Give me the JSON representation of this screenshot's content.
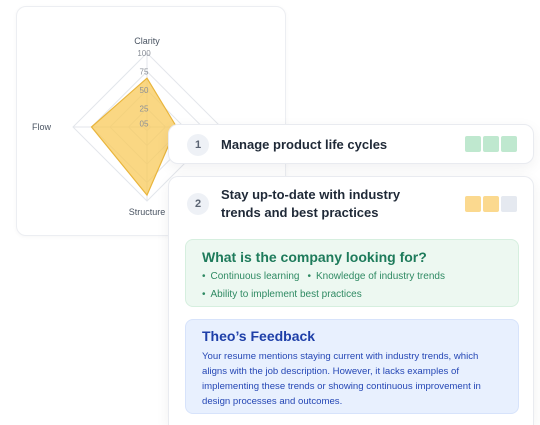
{
  "radar": {
    "axes": [
      "Clarity",
      "",
      "Structure",
      "Flow"
    ],
    "ticks": [
      "100",
      "75",
      "50",
      "25",
      "05"
    ],
    "fill_color": "#f8c95a",
    "stroke_color": "#e9b53c",
    "values": [
      66,
      40,
      92,
      75
    ]
  },
  "rows": [
    {
      "number": "1",
      "title": "Manage product life cycles",
      "rating": [
        "#bfe8cf",
        "#bfe8cf",
        "#bfe8cf"
      ]
    },
    {
      "number": "2",
      "title_line1": "Stay up-to-date with industry",
      "title_line2": "trends and best practices",
      "rating": [
        "#fbd98f",
        "#fbd98f",
        "#e5e9f0"
      ]
    }
  ],
  "looking_for": {
    "title": "What is the company looking for?",
    "items": [
      "Continuous learning",
      "Knowledge of industry trends",
      "Ability to implement best practices"
    ],
    "bullet": "•"
  },
  "feedback": {
    "title": "Theo’s Feedback",
    "lines": [
      "Your resume mentions staying current with industry trends, which",
      "aligns with the job description. However, it lacks examples of",
      "implementing these trends or showing continuous improvement in",
      "design processes and outcomes."
    ]
  }
}
